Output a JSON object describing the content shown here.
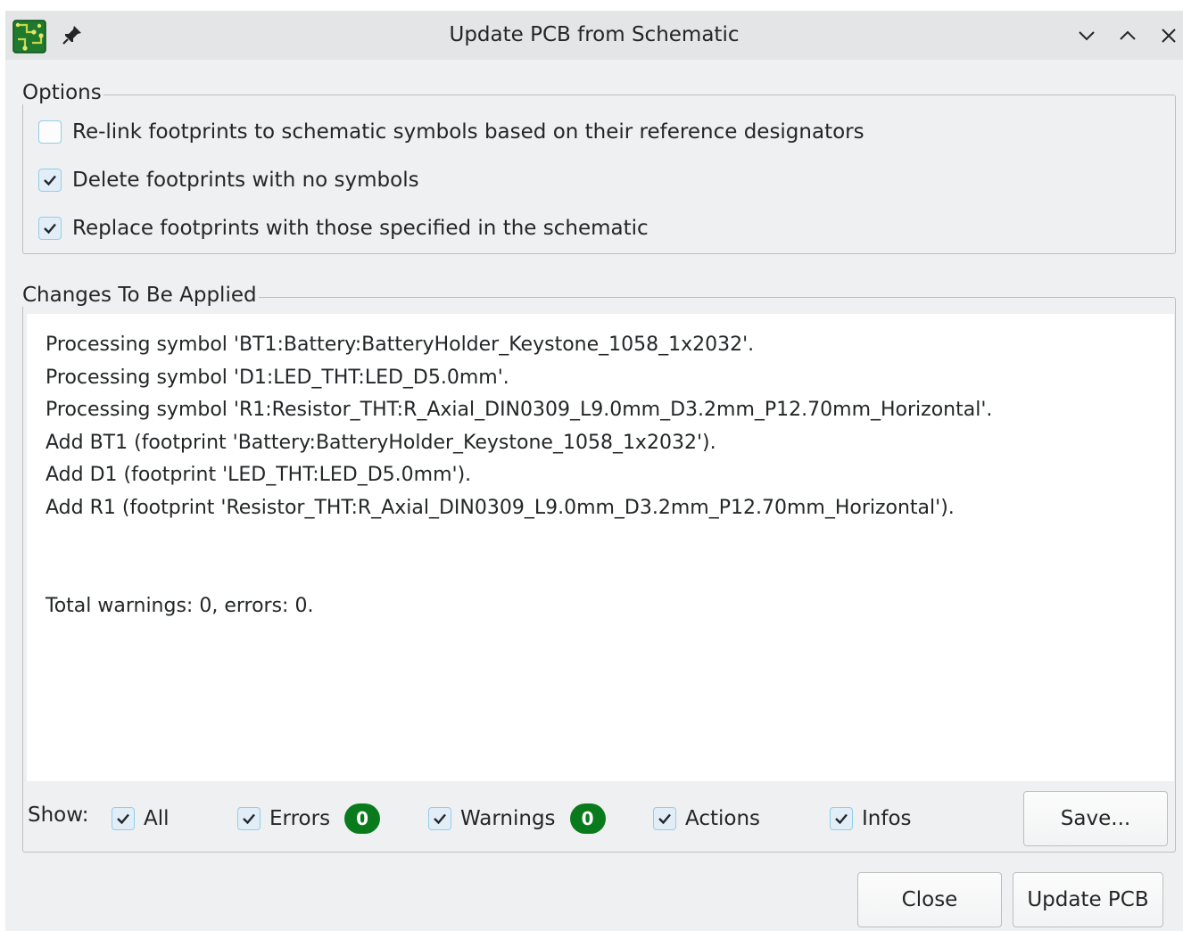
{
  "window": {
    "title": "Update PCB from Schematic"
  },
  "options": {
    "title": "Options",
    "relink_label": "Re-link footprints to schematic symbols based on their reference designators",
    "relink_checked": false,
    "delete_label": "Delete footprints with no symbols",
    "delete_checked": true,
    "replace_label": "Replace footprints with those specified in the schematic",
    "replace_checked": true
  },
  "changes": {
    "title": "Changes To Be Applied",
    "messages": [
      "Processing symbol 'BT1:Battery:BatteryHolder_Keystone_1058_1x2032'.",
      "Processing symbol 'D1:LED_THT:LED_D5.0mm'.",
      "Processing symbol 'R1:Resistor_THT:R_Axial_DIN0309_L9.0mm_D3.2mm_P12.70mm_Horizontal'.",
      "Add BT1 (footprint 'Battery:BatteryHolder_Keystone_1058_1x2032').",
      "Add D1 (footprint 'LED_THT:LED_D5.0mm').",
      "Add R1 (footprint 'Resistor_THT:R_Axial_DIN0309_L9.0mm_D3.2mm_P12.70mm_Horizontal')."
    ],
    "summary": "Total warnings: 0, errors: 0."
  },
  "filters": {
    "show_label": "Show:",
    "all_label": "All",
    "errors_label": "Errors",
    "errors_count": "0",
    "warnings_label": "Warnings",
    "warnings_count": "0",
    "actions_label": "Actions",
    "infos_label": "Infos",
    "save_label": "Save..."
  },
  "buttons": {
    "close_label": "Close",
    "update_label": "Update PCB"
  },
  "colors": {
    "badge": "#0a7b1c",
    "checkbox_border": "#93cee9",
    "window_bg": "#eff0f1"
  },
  "icons": [
    "kicad-pcb-app-icon",
    "pin-icon",
    "minimize-icon",
    "maximize-icon",
    "close-icon",
    "checkmark-icon"
  ]
}
